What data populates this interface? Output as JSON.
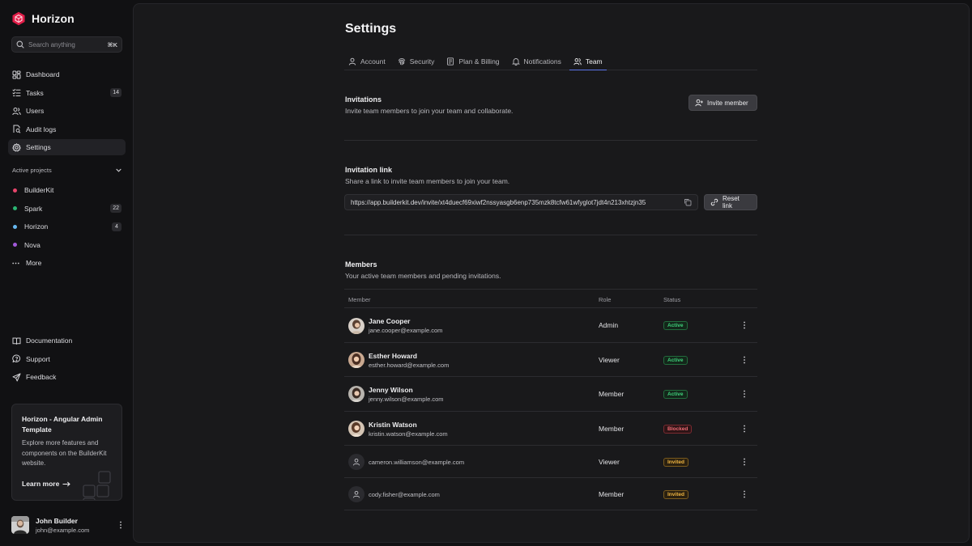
{
  "app": {
    "name": "Horizon"
  },
  "search": {
    "placeholder": "Search anything",
    "shortcut": "⌘K"
  },
  "nav": [
    {
      "label": "Dashboard",
      "icon": "dashboard-icon"
    },
    {
      "label": "Tasks",
      "icon": "tasks-icon",
      "count": "14"
    },
    {
      "label": "Users",
      "icon": "users-icon"
    },
    {
      "label": "Audit logs",
      "icon": "audit-icon"
    },
    {
      "label": "Settings",
      "icon": "gear-icon",
      "active": true
    }
  ],
  "projects": {
    "heading": "Active projects",
    "items": [
      {
        "label": "BuilderKit",
        "color": "#e8456b"
      },
      {
        "label": "Spark",
        "color": "#2bb673",
        "count": "22"
      },
      {
        "label": "Horizon",
        "color": "#66b8f0",
        "count": "4"
      },
      {
        "label": "Nova",
        "color": "#a259d9"
      },
      {
        "label": "More",
        "icon": "more-horizontal-icon"
      }
    ]
  },
  "bottom_nav": [
    {
      "label": "Documentation",
      "icon": "book-icon"
    },
    {
      "label": "Support",
      "icon": "support-icon"
    },
    {
      "label": "Feedback",
      "icon": "send-icon"
    }
  ],
  "promo": {
    "title": "Horizon - Angular Admin Template",
    "text": "Explore more features and components on the BuilderKit website.",
    "link": "Learn more"
  },
  "user": {
    "name": "John Builder",
    "email": "john@example.com"
  },
  "page": {
    "title": "Settings"
  },
  "tabs": [
    {
      "label": "Account",
      "icon": "user-icon"
    },
    {
      "label": "Security",
      "icon": "fingerprint-icon"
    },
    {
      "label": "Plan & Billing",
      "icon": "billing-icon"
    },
    {
      "label": "Notifications",
      "icon": "bell-icon"
    },
    {
      "label": "Team",
      "icon": "team-icon",
      "active": true
    }
  ],
  "invitations": {
    "title": "Invitations",
    "subtitle": "Invite team members to join your team and collaborate.",
    "button": "Invite member"
  },
  "invitation_link": {
    "title": "Invitation link",
    "subtitle": "Share a link to invite team members to join your team.",
    "url": "https://app.builderkit.dev/invite/xt4duecf69xiwf2nssyasgb6enp735mzk8tcfw61wfyglot7jdt4n213xhtzjn35",
    "button": "Reset link"
  },
  "members": {
    "title": "Members",
    "subtitle": "Your active team members and pending invitations.",
    "columns": [
      "Member",
      "Role",
      "Status"
    ],
    "rows": [
      {
        "name": "Jane Cooper",
        "email": "jane.cooper@example.com",
        "role": "Admin",
        "status": "Active"
      },
      {
        "name": "Esther Howard",
        "email": "esther.howard@example.com",
        "role": "Viewer",
        "status": "Active"
      },
      {
        "name": "Jenny Wilson",
        "email": "jenny.wilson@example.com",
        "role": "Member",
        "status": "Active"
      },
      {
        "name": "Kristin Watson",
        "email": "kristin.watson@example.com",
        "role": "Member",
        "status": "Blocked"
      },
      {
        "name": "",
        "email": "cameron.williamson@example.com",
        "role": "Viewer",
        "status": "Invited"
      },
      {
        "name": "",
        "email": "cody.fisher@example.com",
        "role": "Member",
        "status": "Invited"
      }
    ]
  },
  "colors": {
    "accent": "#5b73e8",
    "brand": "#e11d48",
    "active": "#3fcf7a",
    "blocked": "#f06b74",
    "invited": "#f0b541"
  }
}
